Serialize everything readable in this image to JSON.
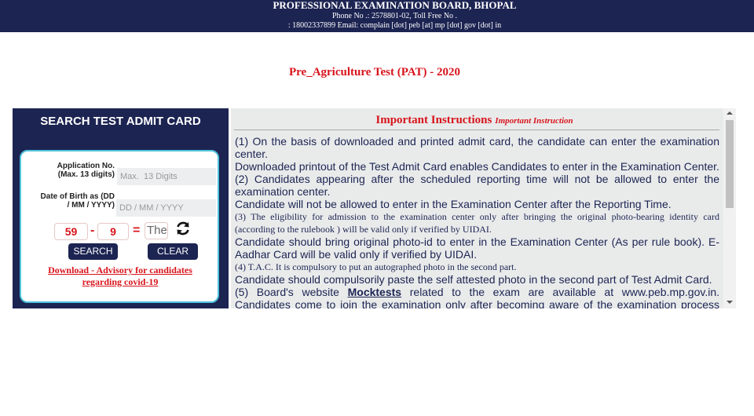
{
  "header": {
    "org_name": "PROFESSIONAL EXAMINATION BOARD, BHOPAL",
    "phone_line": "Phone No .: 2578801-02, Toll Free No .",
    "email_line": ": 18002337899 Email: complain [dot] peb [at] mp [dot] gov [dot] in",
    "background_color": "#1c2452"
  },
  "exam_title": "Pre_Agriculture Test (PAT) - 2020",
  "search_panel": {
    "heading": "SEARCH TEST ADMIT CARD",
    "application_label_1": "Application No.",
    "application_label_2": "(Max. 13 digits)",
    "application_placeholder": "Max.  13 Digits",
    "dob_label_1": "Date of Birth as (DD",
    "dob_label_2": "/ MM / YYYY)",
    "dob_placeholder": "DD / MM / YYYY",
    "captcha": {
      "num1": "59",
      "op": "-",
      "num2": "9",
      "eq": "=",
      "answer": "The",
      "refresh_icon": "refresh-icon"
    },
    "search_button": "SEARCH",
    "clear_button": "CLEAR",
    "advisory_link": "Download - Advisory for candidates regarding covid-19"
  },
  "instructions": {
    "title": "Important Instructions",
    "subtitle": "Important Instruction",
    "items": [
      "(1) On the basis of downloaded and printed admit card, the candidate can enter the examination center.",
      "Downloaded printout of the Test Admit Card enables Candidates to enter in the Examination Center.",
      "(2) Candidates appearing after the scheduled reporting time will not be allowed to enter the examination center.",
      "Candidate will not be allowed to enter in the Examination Center after the Reporting Time.",
      "(3) The eligibility for admission to the examination center only after bringing the original photo-bearing identity card (according to the rulebook   ) will be valid only if verified by UIDAI.",
      " Candidate should bring original photo-id to enter in the Examination Center (As per rule book). E-Aadhar Card will be valid only if verified by UIDAI.",
      "(4) T.A.C. It is compulsory to put an autographed photo in the second part.",
      "Candidate should compulsorily paste the self attested photo in the second part of Test Admit Card."
    ],
    "item5_prefix": "(5) Board's website ",
    "item5_link": "Mocktests",
    "item5_suffix": " related to the exam are available at www.peb.mp.gov.in. Candidates come to join the examination only after becoming aware of the examination process through it."
  },
  "colors": {
    "navy": "#1c2452",
    "accent_red": "#d8141c",
    "panel_bg": "#e9ebeb",
    "form_border": "#4fc3dc"
  }
}
